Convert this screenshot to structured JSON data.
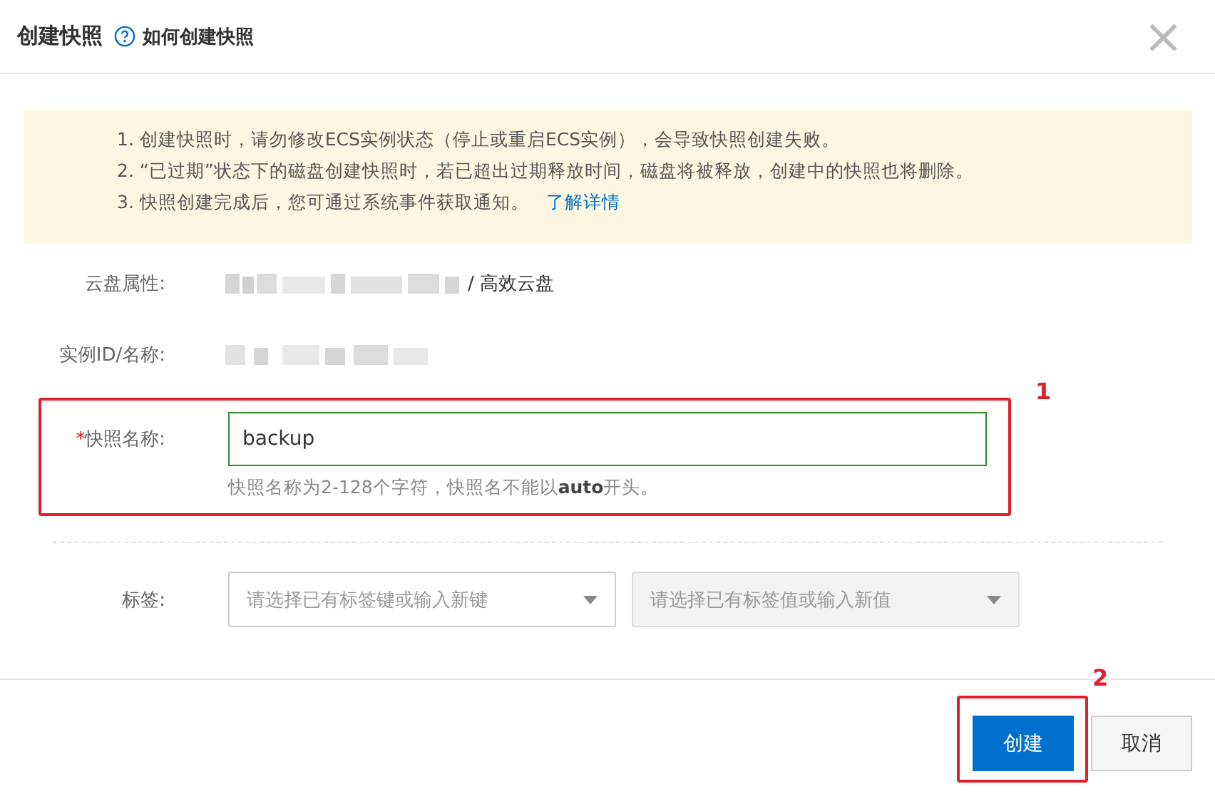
{
  "dialog": {
    "title": "创建快照",
    "help_link": "如何创建快照",
    "close": "×"
  },
  "notice": {
    "lines": [
      {
        "text": "1. 创建快照时，请勿修改ECS实例状态（停止或重启ECS实例），会导致快照创建失败。"
      },
      {
        "text": "2. “已过期”状态下的磁盘创建快照时，若已超出过期释放时间，磁盘将被释放，创建中的快照也将删除。"
      },
      {
        "text": "3. 快照创建完成后，您可通过系统事件获取通知。",
        "link": "了解详情"
      }
    ]
  },
  "disk": {
    "label": "云盘属性:",
    "suffix": "/ 高效云盘"
  },
  "instance": {
    "label": "实例ID/名称:"
  },
  "snapshot_name": {
    "required_mark": "*",
    "label": "快照名称:",
    "value": "backup",
    "hint": "快照名称为2-128个字符，快照名不能以**auto**开头。",
    "annotation": "1"
  },
  "tags": {
    "label": "标签:",
    "selects": [
      {
        "placeholder": "请选择已有标签键或输入新键",
        "disabled": false
      },
      {
        "placeholder": "请选择已有标签值或输入新值",
        "disabled": true
      }
    ]
  },
  "footer": {
    "buttons": [
      {
        "label": "创建",
        "kind": "primary"
      },
      {
        "label": "取消",
        "kind": "default"
      }
    ],
    "annotation": "2"
  }
}
